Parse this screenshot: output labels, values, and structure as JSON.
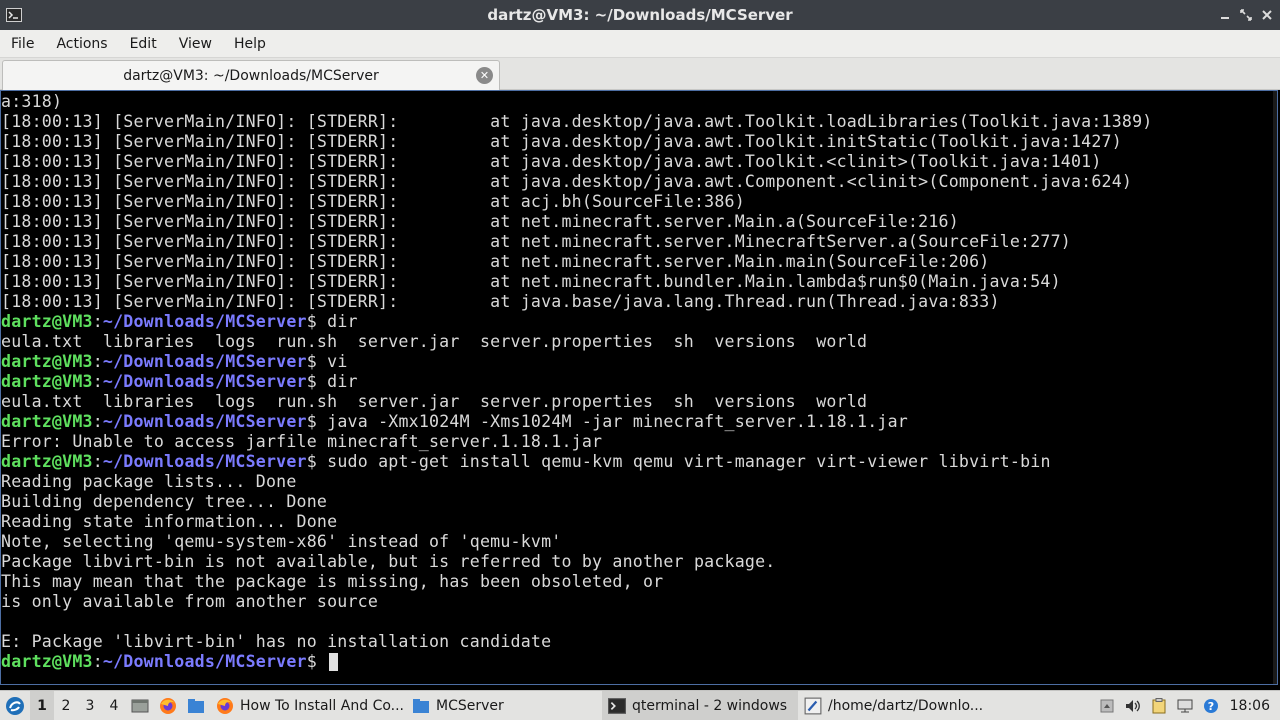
{
  "window": {
    "title": "dartz@VM3: ~/Downloads/MCServer"
  },
  "menu": [
    "File",
    "Actions",
    "Edit",
    "View",
    "Help"
  ],
  "tab": {
    "label": "dartz@VM3: ~/Downloads/MCServer"
  },
  "terminal": {
    "prompt_user": "dartz@VM3",
    "prompt_path": "~/Downloads/MCServer",
    "lines": [
      {
        "type": "out",
        "text": "a:318)"
      },
      {
        "type": "out",
        "text": "[18:00:13] [ServerMain/INFO]: [STDERR]:         at java.desktop/java.awt.Toolkit.loadLibraries(Toolkit.java:1389)"
      },
      {
        "type": "out",
        "text": "[18:00:13] [ServerMain/INFO]: [STDERR]:         at java.desktop/java.awt.Toolkit.initStatic(Toolkit.java:1427)"
      },
      {
        "type": "out",
        "text": "[18:00:13] [ServerMain/INFO]: [STDERR]:         at java.desktop/java.awt.Toolkit.<clinit>(Toolkit.java:1401)"
      },
      {
        "type": "out",
        "text": "[18:00:13] [ServerMain/INFO]: [STDERR]:         at java.desktop/java.awt.Component.<clinit>(Component.java:624)"
      },
      {
        "type": "out",
        "text": "[18:00:13] [ServerMain/INFO]: [STDERR]:         at acj.bh(SourceFile:386)"
      },
      {
        "type": "out",
        "text": "[18:00:13] [ServerMain/INFO]: [STDERR]:         at net.minecraft.server.Main.a(SourceFile:216)"
      },
      {
        "type": "out",
        "text": "[18:00:13] [ServerMain/INFO]: [STDERR]:         at net.minecraft.server.MinecraftServer.a(SourceFile:277)"
      },
      {
        "type": "out",
        "text": "[18:00:13] [ServerMain/INFO]: [STDERR]:         at net.minecraft.server.Main.main(SourceFile:206)"
      },
      {
        "type": "out",
        "text": "[18:00:13] [ServerMain/INFO]: [STDERR]:         at net.minecraft.bundler.Main.lambda$run$0(Main.java:54)"
      },
      {
        "type": "out",
        "text": "[18:00:13] [ServerMain/INFO]: [STDERR]:         at java.base/java.lang.Thread.run(Thread.java:833)"
      },
      {
        "type": "cmd",
        "text": " dir"
      },
      {
        "type": "out",
        "text": "eula.txt  libraries  logs  run.sh  server.jar  server.properties  sh  versions  world"
      },
      {
        "type": "cmd",
        "text": " vi"
      },
      {
        "type": "cmd",
        "text": " dir"
      },
      {
        "type": "out",
        "text": "eula.txt  libraries  logs  run.sh  server.jar  server.properties  sh  versions  world"
      },
      {
        "type": "cmd",
        "text": " java -Xmx1024M -Xms1024M -jar minecraft_server.1.18.1.jar"
      },
      {
        "type": "out",
        "text": "Error: Unable to access jarfile minecraft_server.1.18.1.jar"
      },
      {
        "type": "cmd",
        "text": " sudo apt-get install qemu-kvm qemu virt-manager virt-viewer libvirt-bin"
      },
      {
        "type": "out",
        "text": "Reading package lists... Done"
      },
      {
        "type": "out",
        "text": "Building dependency tree... Done"
      },
      {
        "type": "out",
        "text": "Reading state information... Done"
      },
      {
        "type": "out",
        "text": "Note, selecting 'qemu-system-x86' instead of 'qemu-kvm'"
      },
      {
        "type": "out",
        "text": "Package libvirt-bin is not available, but is referred to by another package."
      },
      {
        "type": "out",
        "text": "This may mean that the package is missing, has been obsoleted, or"
      },
      {
        "type": "out",
        "text": "is only available from another source"
      },
      {
        "type": "out",
        "text": ""
      },
      {
        "type": "out",
        "text": "E: Package 'libvirt-bin' has no installation candidate"
      },
      {
        "type": "cmd",
        "text": " ",
        "cursor": true
      }
    ]
  },
  "taskbar": {
    "workspaces": [
      "1",
      "2",
      "3",
      "4"
    ],
    "active_workspace": "1",
    "tasks": [
      {
        "label": "How To Install And Co...",
        "icon": "firefox-icon"
      },
      {
        "label": "MCServer",
        "icon": "folder-icon"
      },
      {
        "label": "qterminal - 2 windows",
        "icon": "terminal-icon",
        "active": true
      },
      {
        "label": "/home/dartz/Downlo...",
        "icon": "text-editor-icon"
      }
    ],
    "clock": "18:06"
  }
}
